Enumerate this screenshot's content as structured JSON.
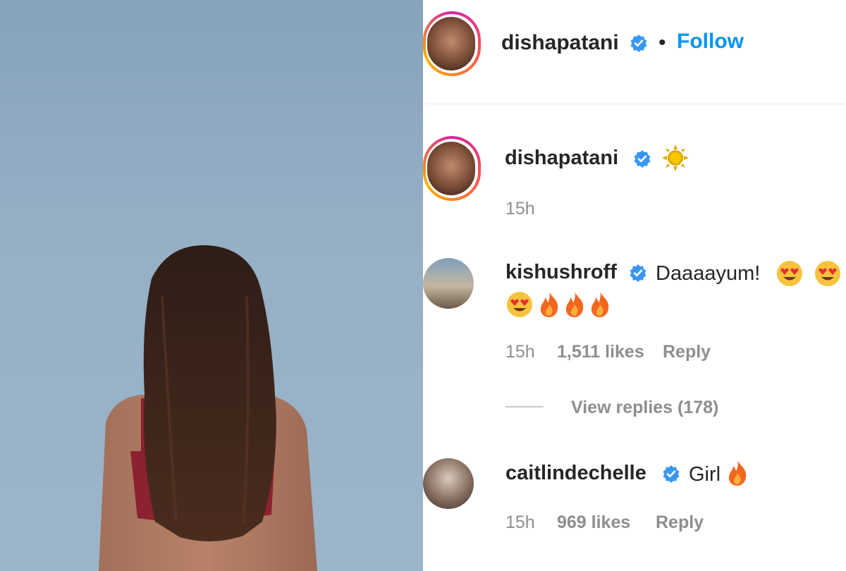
{
  "post": {
    "owner": "dishapatani",
    "follow_label": "Follow",
    "dot": "•"
  },
  "caption": {
    "username": "dishapatani",
    "icon": "sun-emoji",
    "time": "15h"
  },
  "comments": [
    {
      "username": "kishushroff",
      "text": "Daaaayum!",
      "emojis_line1": [
        "heart-eyes",
        "heart-eyes"
      ],
      "emojis_line2": [
        "heart-eyes",
        "fire",
        "fire",
        "fire"
      ],
      "time": "15h",
      "likes": "1,511 likes",
      "reply": "Reply",
      "view_replies": "View replies (178)"
    },
    {
      "username": "caitlindechelle",
      "text": "Girl",
      "emojis": [
        "fire"
      ],
      "time": "15h",
      "likes": "969 likes",
      "reply": "Reply"
    }
  ],
  "colors": {
    "link": "#0095f6",
    "text": "#262626",
    "meta": "#8e8e8e",
    "verified": "#3897f0"
  }
}
